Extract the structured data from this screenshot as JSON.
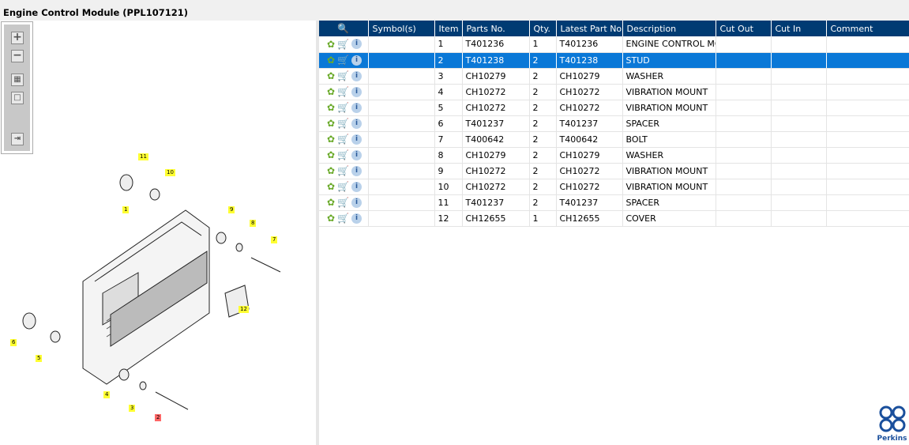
{
  "title": "Engine Control Module (PPL107121)",
  "toolbar": {
    "zoom_in": "+",
    "zoom_out": "−",
    "fit": "▦",
    "reset": "□",
    "toggle": "⇥"
  },
  "callouts": [
    "11",
    "10",
    "1",
    "9",
    "8",
    "7",
    "12",
    "6",
    "5",
    "4",
    "3",
    "2"
  ],
  "selected_callout": "2",
  "table": {
    "headers": [
      "Symbol(s)",
      "Item",
      "Parts No.",
      "Qty.",
      "Latest Part No.",
      "Description",
      "Cut Out",
      "Cut In",
      "Comment"
    ],
    "rows": [
      {
        "item": "1",
        "part": "T401236",
        "qty": "1",
        "latest": "T401236",
        "desc": "ENGINE CONTROL MODULE"
      },
      {
        "item": "2",
        "part": "T401238",
        "qty": "2",
        "latest": "T401238",
        "desc": "STUD"
      },
      {
        "item": "3",
        "part": "CH10279",
        "qty": "2",
        "latest": "CH10279",
        "desc": "WASHER"
      },
      {
        "item": "4",
        "part": "CH10272",
        "qty": "2",
        "latest": "CH10272",
        "desc": "VIBRATION MOUNT"
      },
      {
        "item": "5",
        "part": "CH10272",
        "qty": "2",
        "latest": "CH10272",
        "desc": "VIBRATION MOUNT"
      },
      {
        "item": "6",
        "part": "T401237",
        "qty": "2",
        "latest": "T401237",
        "desc": "SPACER"
      },
      {
        "item": "7",
        "part": "T400642",
        "qty": "2",
        "latest": "T400642",
        "desc": "BOLT"
      },
      {
        "item": "8",
        "part": "CH10279",
        "qty": "2",
        "latest": "CH10279",
        "desc": "WASHER"
      },
      {
        "item": "9",
        "part": "CH10272",
        "qty": "2",
        "latest": "CH10272",
        "desc": "VIBRATION MOUNT"
      },
      {
        "item": "10",
        "part": "CH10272",
        "qty": "2",
        "latest": "CH10272",
        "desc": "VIBRATION MOUNT"
      },
      {
        "item": "11",
        "part": "T401237",
        "qty": "2",
        "latest": "T401237",
        "desc": "SPACER"
      },
      {
        "item": "12",
        "part": "CH12655",
        "qty": "1",
        "latest": "CH12655",
        "desc": "COVER"
      }
    ],
    "selected_item": "2"
  },
  "logo": "Perkins",
  "colors": {
    "header": "#003b73",
    "selected": "#0a78d7",
    "callout": "#ffff33"
  }
}
